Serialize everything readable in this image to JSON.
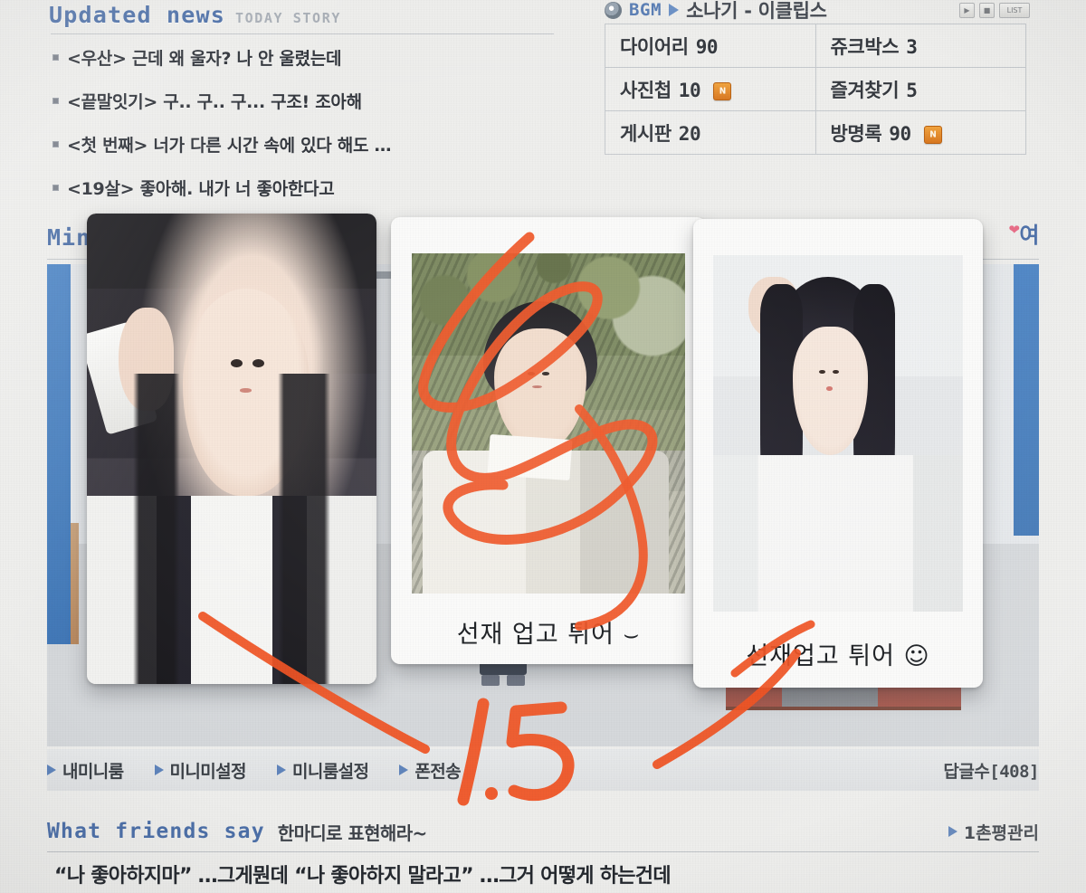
{
  "news": {
    "title": "Updated news",
    "subtitle": "TODAY STORY",
    "items": [
      "<우산> 근데 왜 울자? 나 안 울렸는데",
      "<끝말잇기> 구.. 구.. 구... 구조! 조아해",
      "<첫 번째> 너가 다른 시간 속에 있다 해도 …",
      "<19살> 좋아해. 내가 너 좋아한다고"
    ]
  },
  "bgm": {
    "label": "BGM",
    "track": "소나기 - 이클립스",
    "play_icon": "play-icon",
    "disc_icon": "cd-disc-icon",
    "controls": [
      "▶",
      "■",
      "LIST"
    ]
  },
  "counters": [
    {
      "label": "다이어리",
      "count": "90",
      "badge": ""
    },
    {
      "label": "쥬크박스",
      "count": "3",
      "badge": ""
    },
    {
      "label": "사진첩",
      "count": "10",
      "badge": "N"
    },
    {
      "label": "즐겨찾기",
      "count": "5",
      "badge": ""
    },
    {
      "label": "게시판",
      "count": "20",
      "badge": ""
    },
    {
      "label": "방명록",
      "count": "90",
      "badge": "N"
    }
  ],
  "headings": {
    "left": "Min",
    "right": "여"
  },
  "nav": {
    "items": [
      "내미니룸",
      "미니미설정",
      "미니룸설정",
      "폰전송"
    ],
    "reply_count": "답글수[408]"
  },
  "friends": {
    "title": "What friends say",
    "subtitle": "한마디로 표현해라~",
    "manage_link": "1촌평관리"
  },
  "comment": "“나 좋아하지마” …그게뭔데 “나 좋아하지 말라고” …그거 어떻게 하는건데",
  "cards": [
    {
      "caption": "",
      "name": "photocard-left"
    },
    {
      "caption": "선재 업고 튀어  ⌣",
      "name": "photocard-middle"
    },
    {
      "caption": "선재업고 튀어 ☺",
      "name": "photocard-right"
    }
  ],
  "handwriting": {
    "number": "1.5",
    "ink_color": "#f0501e"
  },
  "colors": {
    "link_blue": "#4c6fa8",
    "heading_blue": "#5b7fb5",
    "marker_orange": "#f0501e",
    "badge_orange": "#e0831f",
    "page_bg": "#eeeeec"
  }
}
